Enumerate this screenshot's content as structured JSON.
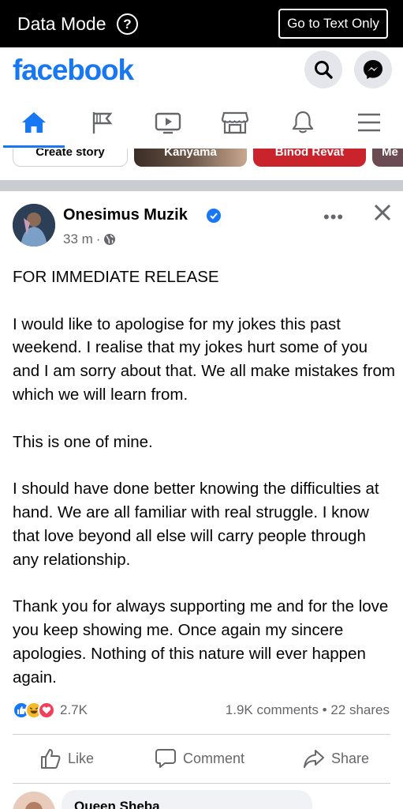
{
  "data_bar": {
    "title": "Data Mode",
    "help_icon": "?",
    "text_only_label": "Go to Text Only"
  },
  "header": {
    "logo": "facebook",
    "search_icon": "search-icon",
    "messenger_icon": "messenger-icon"
  },
  "nav": {
    "tabs": [
      {
        "name": "home",
        "icon": "home-icon",
        "active": true
      },
      {
        "name": "pages",
        "icon": "flag-icon",
        "active": false
      },
      {
        "name": "watch",
        "icon": "video-icon",
        "active": false
      },
      {
        "name": "marketplace",
        "icon": "store-icon",
        "active": false
      },
      {
        "name": "notifications",
        "icon": "bell-icon",
        "active": false
      },
      {
        "name": "menu",
        "icon": "menu-icon",
        "active": false
      }
    ]
  },
  "stories": {
    "create_label": "Create story",
    "items": [
      "Kanyama",
      "Binod Revat",
      "Me"
    ]
  },
  "post": {
    "author": "Onesimus Muzik",
    "verified": true,
    "time": "33 m",
    "separator": "·",
    "privacy_icon": "globe-icon",
    "paragraphs": [
      "FOR IMMEDIATE RELEASE",
      "I would like to apologise for my jokes this past weekend. I realise that my jokes hurt some of you and I am sorry about that. We all make mistakes from which we will learn from.",
      "This is one of mine.",
      "I should have done better knowing the difficulties at hand.  We are all familiar with real struggle. I know that love beyond all else will carry people through any relationship.",
      "Thank you for always supporting me and for the love you keep showing me. Once again my sincere apologies. Nothing of this nature will ever happen again."
    ],
    "reaction_count": "2.7K",
    "comments": "1.9K comments",
    "stats_separator": "•",
    "shares": "22 shares",
    "actions": {
      "like": "Like",
      "comment": "Comment",
      "share": "Share"
    }
  },
  "comment_preview": {
    "author": "Queen Sheba"
  },
  "colors": {
    "brand": "#1877f2",
    "secondary_text": "#65676b"
  }
}
